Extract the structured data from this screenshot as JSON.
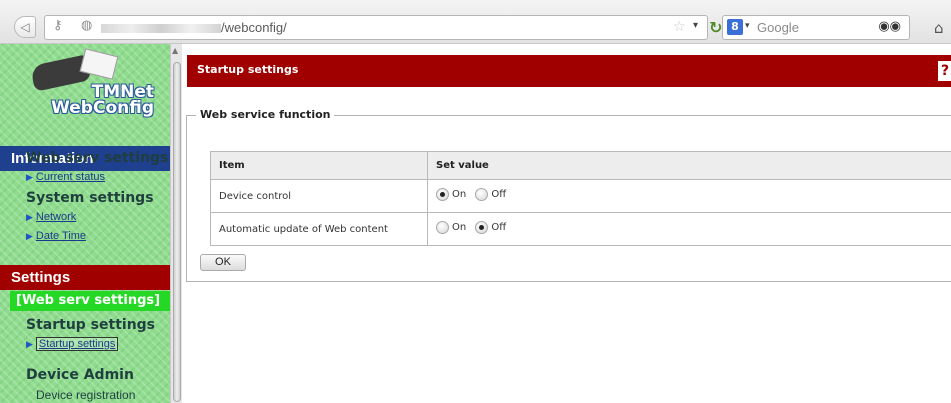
{
  "browser": {
    "url_suffix": "/webconfig/",
    "search_placeholder": "Google",
    "search_engine_glyph": "8"
  },
  "sidebar": {
    "logo_line1": "TMNet",
    "logo_line2": "WebConfig",
    "information_header": "Information",
    "web_serv_group": "Web serv settings",
    "current_status_link": "Current status",
    "system_group": "System settings",
    "network_link": "Network",
    "datetime_link": "Date Time",
    "settings_header": "Settings",
    "current_section": "[Web serv settings]",
    "startup_group": "Startup settings",
    "startup_link": "Startup settings",
    "device_admin_group": "Device Admin",
    "device_registration": "Device registration"
  },
  "main": {
    "title": "Startup settings",
    "help_glyph": "?",
    "fieldset_legend": "Web service function",
    "table": {
      "headers": [
        "Item",
        "Set value"
      ],
      "rows": [
        {
          "item": "Device control",
          "on_label": "On",
          "off_label": "Off",
          "value": "On"
        },
        {
          "item": "Automatic update of Web content",
          "on_label": "On",
          "off_label": "Off",
          "value": "Off"
        }
      ]
    },
    "ok_label": "OK"
  },
  "colors": {
    "header_red": "#a00000",
    "info_blue": "#1f3f8f",
    "sidebar_green": "#8fdc8f",
    "current_green": "#26d826"
  },
  "icons": [
    "back-icon",
    "key-icon",
    "globe-icon",
    "star-icon",
    "reload-icon",
    "binoculars-icon",
    "home-icon",
    "triangle-icon",
    "help-icon"
  ]
}
